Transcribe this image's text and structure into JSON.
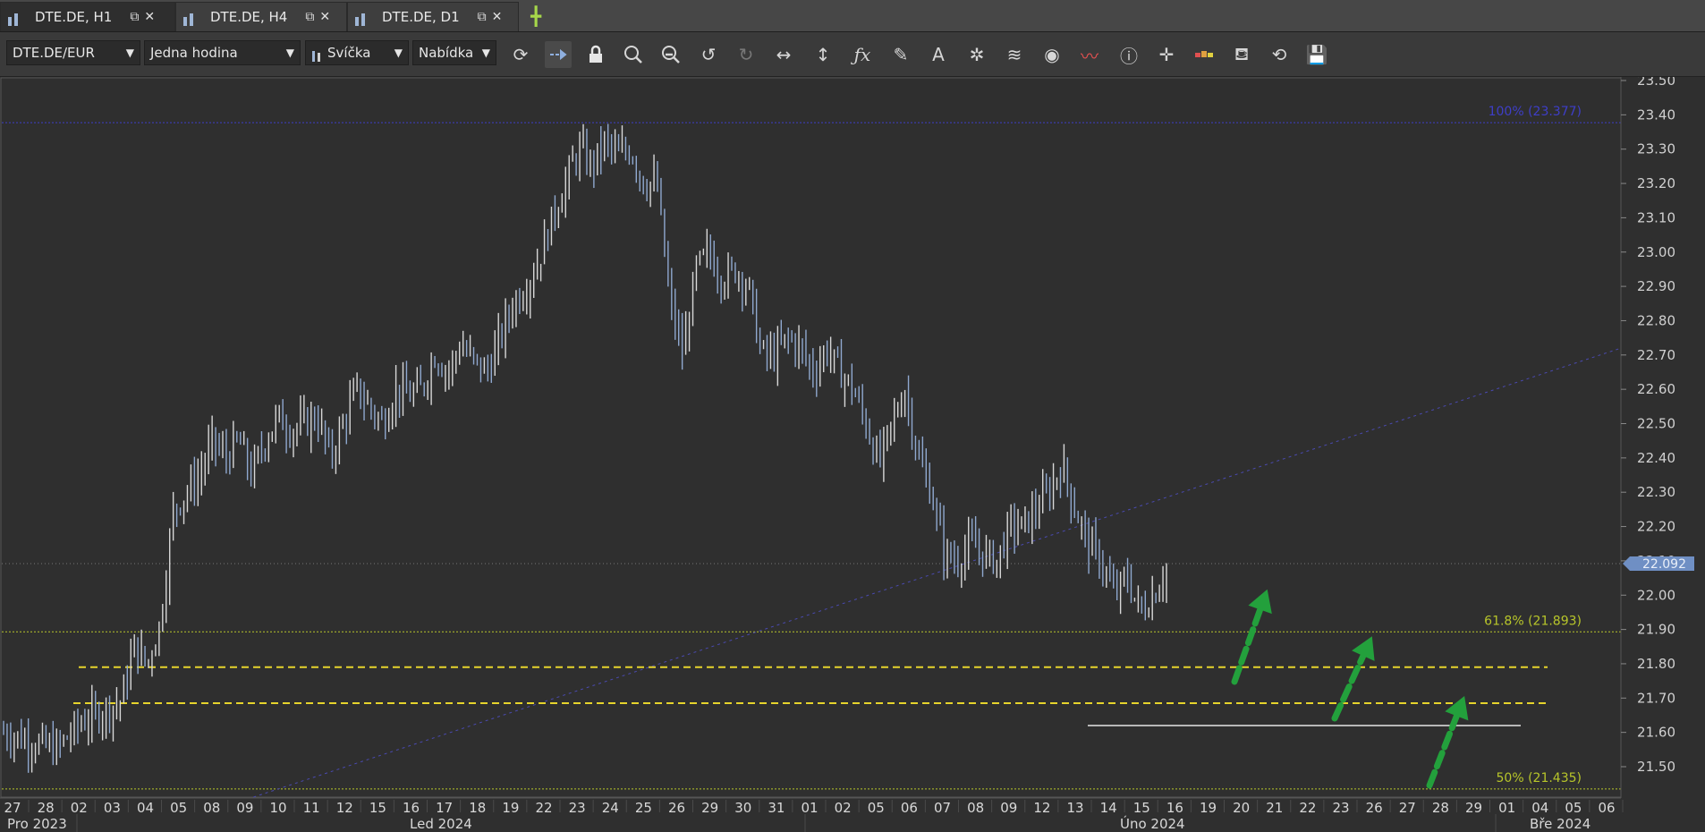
{
  "tabs": [
    {
      "label": "DTE.DE, H1",
      "active": true
    },
    {
      "label": "DTE.DE, H4",
      "active": false
    },
    {
      "label": "DTE.DE, D1",
      "active": false
    }
  ],
  "toolbar": {
    "instrument": "DTE.DE/EUR",
    "period": "Jedna hodina",
    "chart_type": "Svíčka",
    "price_side": "Nabídka"
  },
  "colors": {
    "background": "#2f2f2f",
    "bar": "#d8d8d8",
    "bar_alt": "#8fa8cf",
    "fib_100": "#3e3ec8",
    "fib_other": "#b8c62a",
    "support_line": "#e6d42c",
    "arrow": "#23a03c",
    "current_price_bg": "#6f8fc4"
  },
  "chart_data": {
    "type": "bar",
    "instrument": "DTE.DE",
    "timeframe": "H1",
    "y_axis": {
      "min": 21.45,
      "max": 23.5,
      "ticks": [
        "23.50",
        "23.40",
        "23.30",
        "23.20",
        "23.10",
        "23.00",
        "22.90",
        "22.80",
        "22.70",
        "22.60",
        "22.50",
        "22.40",
        "22.30",
        "22.20",
        "22.10",
        "22.00",
        "21.90",
        "21.80",
        "21.70",
        "21.60",
        "21.50"
      ]
    },
    "current_price": "22.092",
    "fib_levels": [
      {
        "label": "100% (23.377)",
        "value": 23.377
      },
      {
        "label": "61.8% (21.893)",
        "value": 21.893
      },
      {
        "label": "50% (21.435)",
        "value": 21.435
      }
    ],
    "support_levels": [
      21.79,
      21.685
    ],
    "horizontal_line": 21.62,
    "x_ticks": [
      "27",
      "28",
      "02",
      "03",
      "04",
      "05",
      "08",
      "09",
      "10",
      "11",
      "12",
      "15",
      "16",
      "17",
      "18",
      "19",
      "22",
      "23",
      "24",
      "25",
      "26",
      "29",
      "30",
      "31",
      "01",
      "02",
      "05",
      "06",
      "07",
      "08",
      "09",
      "12",
      "13",
      "14",
      "15",
      "16",
      "19",
      "20",
      "21",
      "22",
      "23",
      "26",
      "27",
      "28",
      "29",
      "01",
      "04",
      "05",
      "06"
    ],
    "month_labels": [
      "Pro 2023",
      "Led 2024",
      "Úno 2024",
      "Bře 2024"
    ],
    "price_path": [
      [
        0,
        21.6
      ],
      [
        4,
        21.55
      ],
      [
        6,
        21.63
      ],
      [
        9,
        21.69
      ],
      [
        10,
        21.85
      ],
      [
        11,
        21.8
      ],
      [
        12,
        21.92
      ],
      [
        13,
        22.25
      ],
      [
        14,
        22.3
      ],
      [
        15,
        22.35
      ],
      [
        16,
        22.45
      ],
      [
        17,
        22.4
      ],
      [
        18,
        22.45
      ],
      [
        19,
        22.35
      ],
      [
        20,
        22.45
      ],
      [
        21,
        22.52
      ],
      [
        22,
        22.48
      ],
      [
        23,
        22.5
      ],
      [
        24,
        22.52
      ],
      [
        25,
        22.4
      ],
      [
        26,
        22.5
      ],
      [
        27,
        22.6
      ],
      [
        28,
        22.55
      ],
      [
        29,
        22.5
      ],
      [
        30,
        22.6
      ],
      [
        31,
        22.58
      ],
      [
        32,
        22.6
      ],
      [
        33,
        22.7
      ],
      [
        34,
        22.65
      ],
      [
        35,
        22.73
      ],
      [
        36,
        22.68
      ],
      [
        37,
        22.65
      ],
      [
        38,
        22.75
      ],
      [
        39,
        22.85
      ],
      [
        40,
        22.9
      ],
      [
        41,
        22.98
      ],
      [
        42,
        23.1
      ],
      [
        43,
        23.2
      ],
      [
        44,
        23.3
      ],
      [
        45,
        23.25
      ],
      [
        46,
        23.32
      ],
      [
        47,
        23.28
      ],
      [
        48,
        23.3
      ],
      [
        49,
        23.2
      ],
      [
        50,
        23.2
      ],
      [
        51,
        22.85
      ],
      [
        52,
        22.7
      ],
      [
        53,
        22.95
      ],
      [
        54,
        23.0
      ],
      [
        55,
        22.92
      ],
      [
        56,
        22.95
      ],
      [
        57,
        22.9
      ],
      [
        58,
        22.7
      ],
      [
        59,
        22.7
      ],
      [
        60,
        22.75
      ],
      [
        61,
        22.72
      ],
      [
        62,
        22.65
      ],
      [
        63,
        22.72
      ],
      [
        64,
        22.65
      ],
      [
        65,
        22.6
      ],
      [
        66,
        22.5
      ],
      [
        67,
        22.38
      ],
      [
        68,
        22.5
      ],
      [
        69,
        22.6
      ],
      [
        70,
        22.4
      ],
      [
        71,
        22.3
      ],
      [
        72,
        22.12
      ],
      [
        73,
        22.1
      ],
      [
        74,
        22.15
      ],
      [
        75,
        22.12
      ],
      [
        76,
        22.1
      ],
      [
        77,
        22.2
      ],
      [
        78,
        22.2
      ],
      [
        79,
        22.25
      ],
      [
        80,
        22.3
      ],
      [
        81,
        22.38
      ],
      [
        82,
        22.25
      ],
      [
        83,
        22.15
      ],
      [
        84,
        22.1
      ],
      [
        85,
        22.0
      ],
      [
        86,
        22.05
      ],
      [
        87,
        21.95
      ],
      [
        88,
        22.0
      ],
      [
        89,
        22.08
      ]
    ]
  }
}
